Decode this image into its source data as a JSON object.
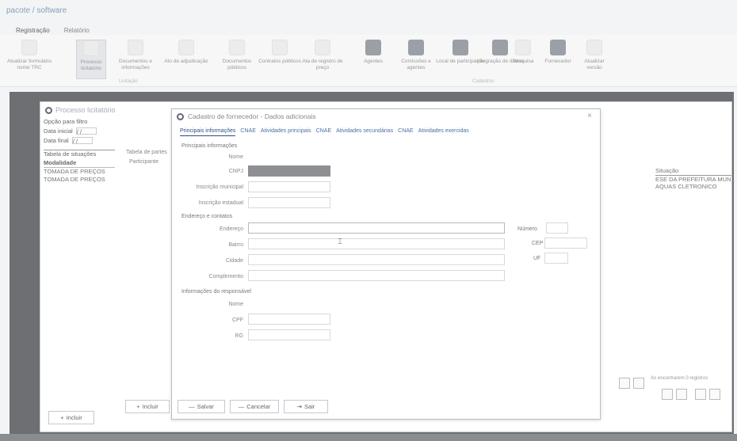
{
  "app": {
    "title": "pacote / software"
  },
  "ribbon": {
    "tabs": [
      "Registração",
      "Relatório"
    ],
    "items": [
      {
        "label": "Atualizar formulário nome TRC",
        "icon": "document-icon"
      },
      {
        "label": "Processo licitatório",
        "icon": "process-icon"
      },
      {
        "label": "Documentos e informações",
        "icon": "document-icon"
      },
      {
        "label": "Ato de adjudicação",
        "icon": "document-icon"
      },
      {
        "label": "Documentos públicos",
        "icon": "document-icon"
      },
      {
        "label": "Contratos públicos",
        "icon": "document-icon"
      },
      {
        "label": "Ata de registro de preço",
        "icon": "document-icon"
      },
      {
        "label": "Agentes",
        "icon": "agent-icon"
      },
      {
        "label": "Comissões e agentes",
        "icon": "team-icon"
      },
      {
        "label": "Local de participação",
        "icon": "building-icon"
      },
      {
        "label": "Integração de dados",
        "icon": "sync-icon"
      },
      {
        "label": "Pesquisa",
        "icon": "search-icon"
      },
      {
        "label": "Fornecedor",
        "icon": "user-icon"
      },
      {
        "label": "Atualizar versão",
        "icon": "update-icon"
      }
    ],
    "group_labels": [
      "Licitação",
      "Cadastros"
    ]
  },
  "background_window": {
    "title": "Processo licitatório",
    "filter_title": "Opção para filtro",
    "filter_rows": [
      {
        "label": "Data inicial",
        "value": "/ /"
      },
      {
        "label": "Data final",
        "value": "/ /"
      }
    ],
    "table_title": "Tabela de situações",
    "table_header": "Modalidade",
    "table_items": [
      "TOMADA DE PREÇOS",
      "TOMADA DE PREÇOS"
    ],
    "panel_labels": [
      "Tabela de partes",
      "Participante"
    ],
    "right_header": "Situação",
    "right_items": [
      "ESE DA PREFEITURA MUN",
      "AQUAS CLETRONICO"
    ],
    "footer_text": "Ao encontrarem 0 registros",
    "left_button": "Incluir"
  },
  "dialog": {
    "title": "Cadastro de fornecedor - Dados adicionais",
    "tabs": [
      "Principais informações",
      "CNAE",
      "Atividades principais",
      "CNAE",
      "Atividades secundárias",
      "CNAE",
      "Atividades exercidas"
    ],
    "sections": {
      "main": "Principais informações",
      "address": "Endereço e contatos",
      "rep": "Informações do responsável"
    },
    "fields": {
      "nome": "Nome",
      "cnpj": "CNPJ",
      "insc_mun": "Inscrição municipal",
      "insc_est": "Inscrição estadual",
      "endereco": "Endereço",
      "bairro": "Bairro",
      "cidade": "Cidade",
      "complemento": "Complemento",
      "numero": "Número",
      "cep": "CEP",
      "uf": "UF",
      "rep_nome": "Nome",
      "rep_cpf": "CPF",
      "rep_rg": "RG"
    },
    "buttons": {
      "incluir": "Incluir",
      "salvar": "Salvar",
      "cancelar": "Cancelar",
      "sair": "Sair"
    }
  }
}
